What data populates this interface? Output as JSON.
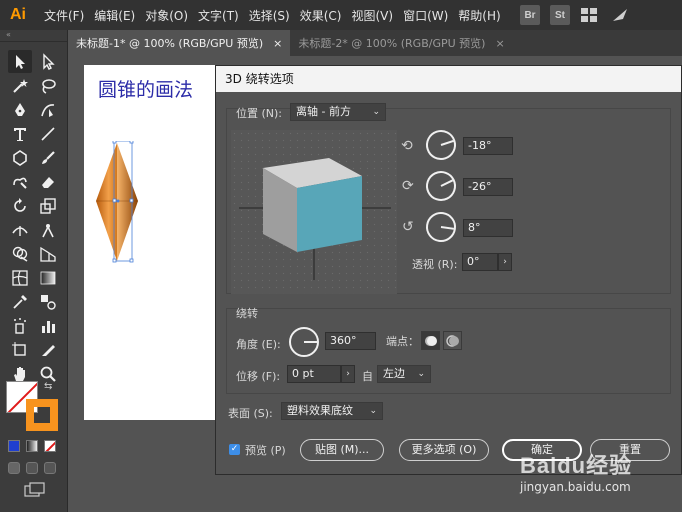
{
  "app": {
    "logo": "Ai",
    "menu": [
      "文件(F)",
      "编辑(E)",
      "对象(O)",
      "文字(T)",
      "选择(S)",
      "效果(C)",
      "视图(V)",
      "窗口(W)",
      "帮助(H)"
    ],
    "right_icons": [
      {
        "label": "Br",
        "icon": "bridge-icon"
      },
      {
        "label": "St",
        "icon": "stock-icon"
      },
      {
        "label": "",
        "icon": "workspace-grid-icon"
      },
      {
        "label": "",
        "icon": "feather-icon"
      }
    ]
  },
  "tabs": [
    {
      "label": "未标题-1* @ 100% (RGB/GPU 预览)",
      "close": "×",
      "active": true
    },
    {
      "label": "未标题-2* @ 100% (RGB/GPU 预览)",
      "close": "×",
      "active": false
    }
  ],
  "toolbar": {
    "collapse": "«",
    "tools": [
      "selection-tool-icon",
      "direct-selection-tool-icon",
      "magic-wand-tool-icon",
      "lasso-tool-icon",
      "pen-tool-icon",
      "curvature-tool-icon",
      "type-tool-icon",
      "line-tool-icon",
      "polygon-tool-icon",
      "paintbrush-tool-icon",
      "shaper-tool-icon",
      "eraser-tool-icon",
      "rotate-tool-icon",
      "scale-tool-icon",
      "width-tool-icon",
      "puppet-warp-tool-icon",
      "shape-builder-tool-icon",
      "perspective-grid-tool-icon",
      "mesh-tool-icon",
      "gradient-tool-icon",
      "eyedropper-tool-icon",
      "blend-tool-icon",
      "symbol-sprayer-tool-icon",
      "column-graph-tool-icon",
      "artboard-tool-icon",
      "slice-tool-icon",
      "hand-tool-icon",
      "zoom-tool-icon"
    ],
    "colors": {
      "fill": "#ffffff",
      "stroke": "#f7931e",
      "none_slash": "#e01b1b"
    }
  },
  "artboard": {
    "title": "圆锥的画法",
    "object_color": "#e07a1c"
  },
  "dialog": {
    "title": "3D 绕转选项",
    "position_label": "位置 (N):",
    "position_value": "离轴 - 前方",
    "x_rotation": "-18°",
    "y_rotation": "-26°",
    "z_rotation": "8°",
    "perspective_label": "透视 (R):",
    "perspective_value": "0°",
    "revolve_section": "绕转",
    "angle_label": "角度 (E):",
    "angle_value": "360°",
    "cap_label": "端点：",
    "offset_label": "位移 (F):",
    "offset_value": "0 pt",
    "from_label": "自",
    "from_value": "左边",
    "surface_label": "表面 (S):",
    "surface_value": "塑料效果底纹",
    "preview_label": "预览 (P)",
    "preview_checked": true,
    "buttons": {
      "map": "贴图 (M)...",
      "more_options": "更多选项 (O)",
      "ok": "确定",
      "reset": "重置"
    },
    "cube_colors": {
      "front": "#58a6b8",
      "side": "#9e9e9e",
      "top": "#d4d4d4"
    }
  },
  "watermark": {
    "main": "Baidu经验",
    "sub": "jingyan.baidu.com"
  }
}
